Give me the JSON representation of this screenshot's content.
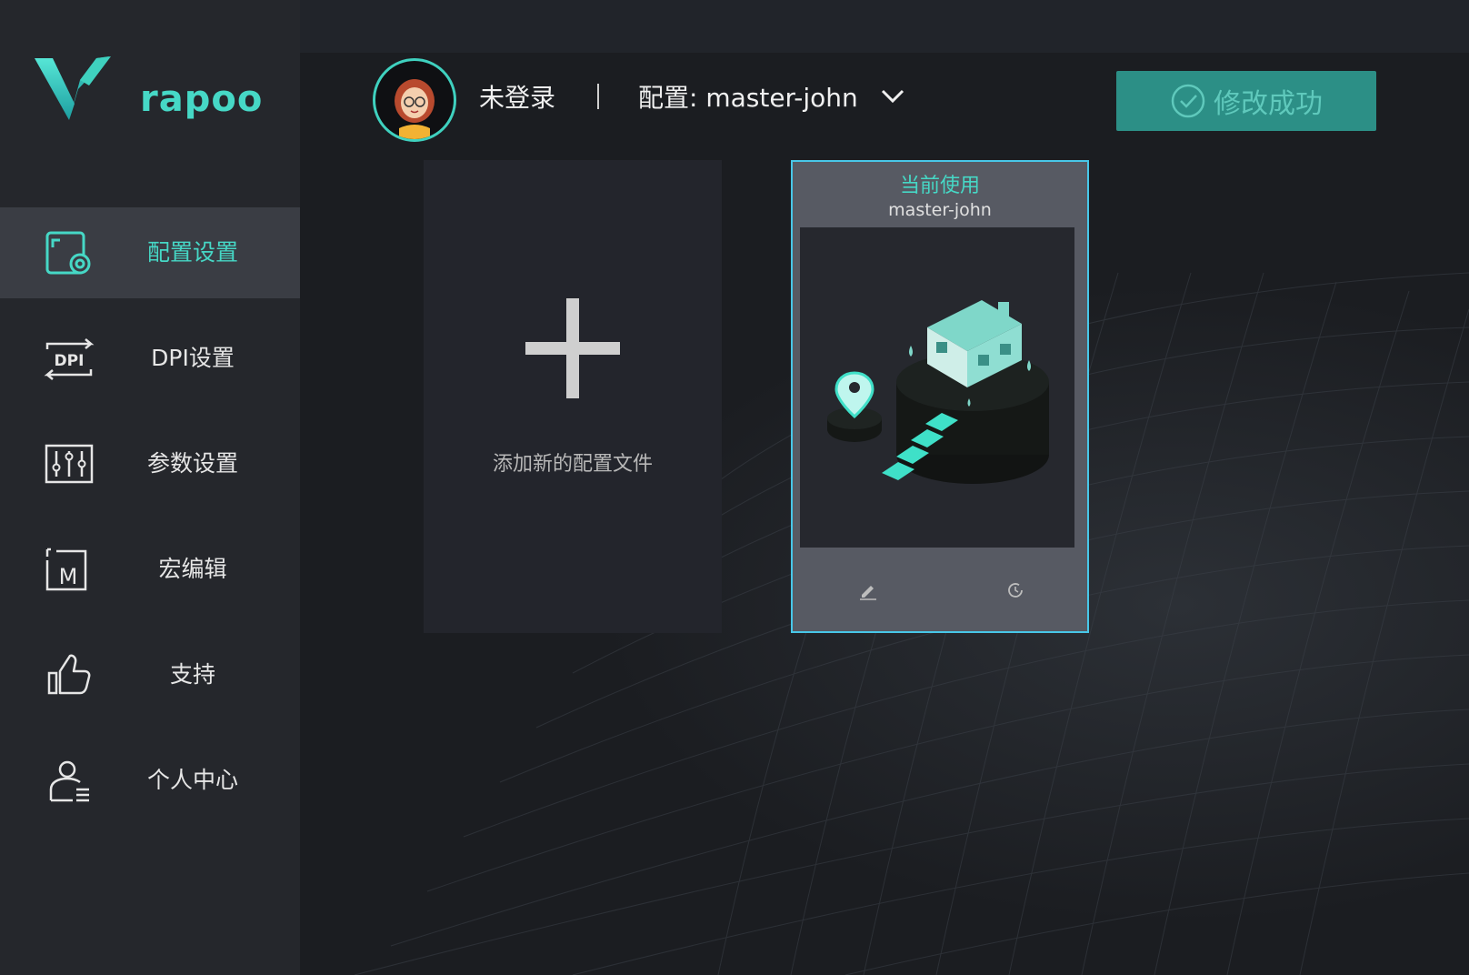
{
  "brand": {
    "logo_text": "rapoo",
    "accent": "#46d8c6"
  },
  "sidebar": {
    "items": [
      {
        "label": "配置设置",
        "icon": "profile-settings-icon",
        "active": true
      },
      {
        "label": "DPI设置",
        "icon": "dpi-icon",
        "active": false
      },
      {
        "label": "参数设置",
        "icon": "sliders-icon",
        "active": false
      },
      {
        "label": "宏编辑",
        "icon": "macro-icon",
        "active": false
      },
      {
        "label": "支持",
        "icon": "thumbs-up-icon",
        "active": false
      },
      {
        "label": "个人中心",
        "icon": "user-icon",
        "active": false
      }
    ]
  },
  "header": {
    "login_status": "未登录",
    "config_label": "配置: master-john",
    "success_button": "修改成功"
  },
  "cards": {
    "add_label": "添加新的配置文件",
    "current_label": "当前使用",
    "profile_name": "master-john"
  }
}
